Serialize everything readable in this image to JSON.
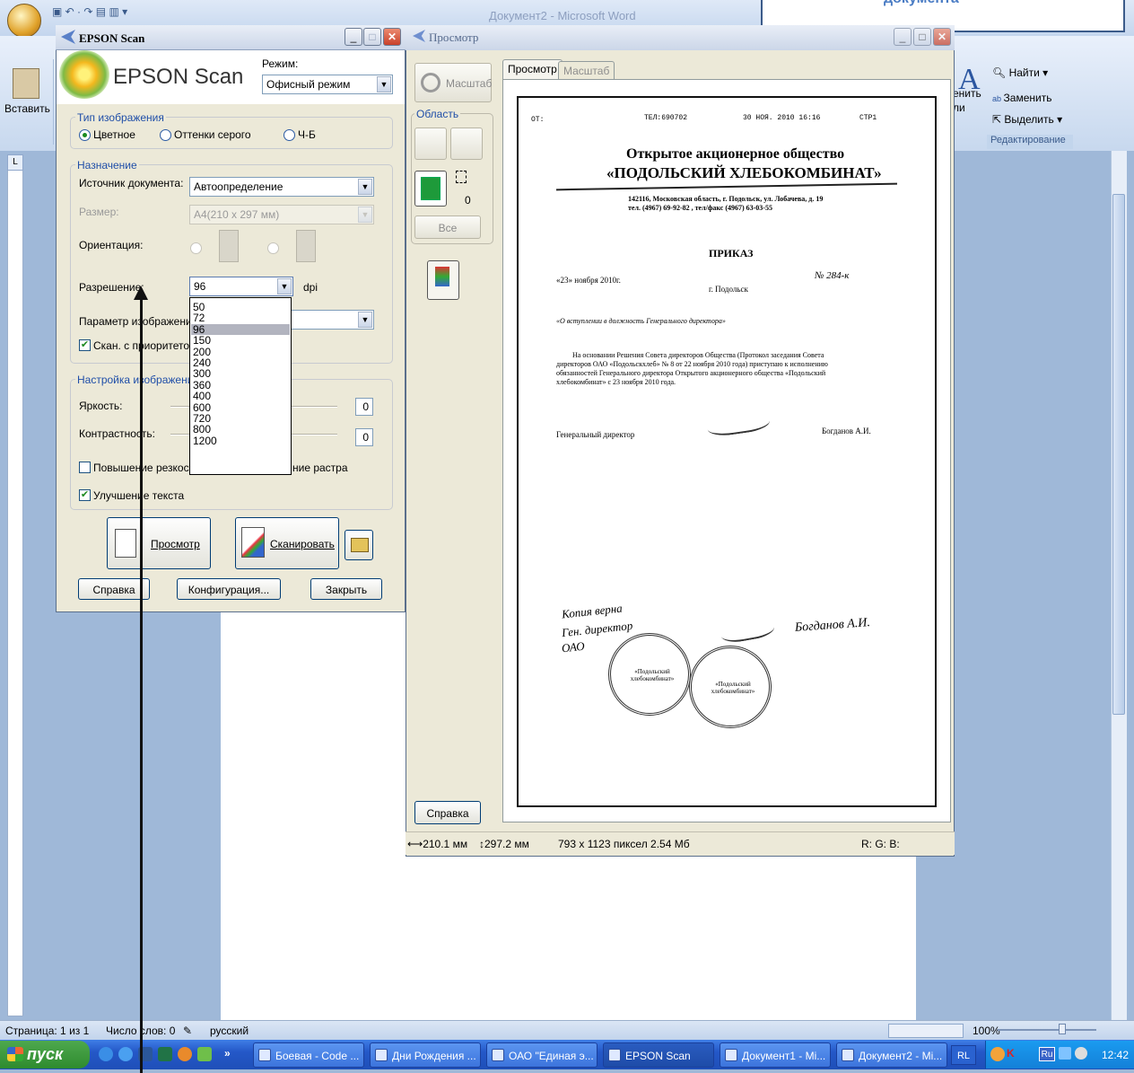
{
  "word": {
    "title": "Документ2 - Microsoft Word",
    "paste_label": "Вставить",
    "edit_group": {
      "find": "Найти",
      "replace": "Заменить",
      "select": "Выделить",
      "label": "Редактирование",
      "styles_partial_1": "енить",
      "styles_partial_2": "ли"
    },
    "ruler_corner": "L",
    "status": {
      "page": "Страница: 1 из 1",
      "words": "Число слов: 0",
      "language": "русский",
      "zoom": "100%"
    }
  },
  "callout": {
    "text": "документа"
  },
  "epson": {
    "title": "EPSON Scan",
    "brand": "EPSON Scan",
    "mode_label": "Режим:",
    "mode_value": "Офисный режим",
    "image_type": {
      "label": "Тип изображения",
      "options": [
        "Цветное",
        "Оттенки серого",
        "Ч-Б"
      ],
      "selected": "Цветное"
    },
    "destination": {
      "label": "Назначение",
      "source_label": "Источник документа:",
      "source_value": "Автоопределение",
      "size_label": "Размер:",
      "size_value": "A4(210 x 297 мм)",
      "orientation_label": "Ориентация:",
      "resolution_label": "Разрешение:",
      "resolution_value": "96",
      "resolution_unit": "dpi",
      "image_param_label": "Параметр изображения:",
      "priority_scan_label": "Скан. с приоритетом с",
      "resolution_options": [
        "50",
        "72",
        "96",
        "150",
        "200",
        "240",
        "300",
        "360",
        "400",
        "600",
        "720",
        "800",
        "1200"
      ]
    },
    "adjust": {
      "label": "Настройка изображения",
      "brightness_label": "Яркость:",
      "brightness_value": "0",
      "contrast_label": "Контрастность:",
      "contrast_value": "0",
      "sharpen_label": "Повышение резкости",
      "descreen_label": "ние растра",
      "text_enh_label": "Улучшение текста"
    },
    "buttons": {
      "preview": "Просмотр",
      "scan": "Сканировать",
      "help": "Справка",
      "config": "Конфигурация...",
      "close": "Закрыть"
    }
  },
  "preview": {
    "title": "Просмотр",
    "zoom_button": "Масштаб",
    "area_label": "Область",
    "marquee_count": "0",
    "all_button": "Все",
    "help_button": "Справка",
    "tabs": [
      "Просмотр",
      "Масштаб"
    ],
    "status_dims": "210.1 мм",
    "status_dims_h": "297.2 мм",
    "status_pixels": "793 x 1123 пиксел 2.54 Мб",
    "status_rgb": "R: G: B:"
  },
  "document": {
    "fax_from": "ОТ:",
    "fax_tel": "ТЕЛ:690702",
    "fax_date": "30 НОЯ. 2010 16:16",
    "fax_page": "СТР1",
    "org_line1": "Открытое акционерное общество",
    "org_line2": "«ПОДОЛЬСКИЙ ХЛЕБОКОМБИНАТ»",
    "address1": "142116, Московская область, г. Подольск, ул. Лобачева, д. 19",
    "address2": "тел. (4967) 69-92-82 , тел/факс (4967) 63-03-55",
    "heading": "ПРИКАЗ",
    "date": "«23» ноября 2010г.",
    "number": "№ 284-к",
    "city": "г. Подольск",
    "subject": "«О вступлении в должность Генерального директора»",
    "body": [
      "На основании Решения Совета директоров Общества (Протокол заседания Совета",
      "директоров ОАО «Подольскхлеб» № 8 от 22 ноября 2010 года) приступаю к исполнению",
      "обязанностей Генерального директора Открытого акционерного общества «Подольский",
      "хлебокомбинат» с 23 ноября 2010 года."
    ],
    "signer_title": "Генеральный директор",
    "signer_name": "Богданов А.И.",
    "handwriting": [
      "Копия верна",
      "Ген. директор",
      "ОАО",
      "Богданов А.И."
    ],
    "stamp_text": "«Подольский хлебокомбинат»"
  },
  "taskbar": {
    "start": "пуск",
    "items": [
      {
        "label": "Боевая - Code ...",
        "active": false
      },
      {
        "label": "Дни Рождения ...",
        "active": false
      },
      {
        "label": "ОАО \"Единая э...",
        "active": false
      },
      {
        "label": "EPSON Scan",
        "active": true
      },
      {
        "label": "Документ1 - Mi...",
        "active": false
      },
      {
        "label": "Документ2 - Mi...",
        "active": false
      }
    ],
    "lang": "RL",
    "lang2": "Ru",
    "clock": "12:42"
  }
}
